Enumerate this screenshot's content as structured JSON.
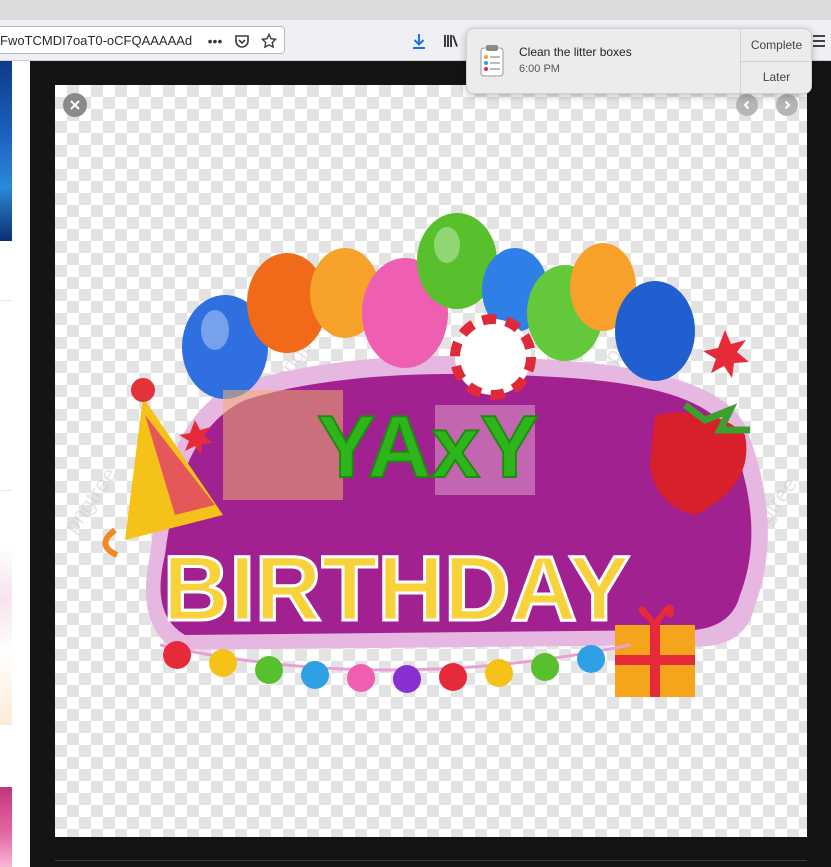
{
  "browser": {
    "url_text": "FwoTCMDI7oaT0-oCFQAAAAAd",
    "icons": {
      "more": "more-actions-icon",
      "pocket": "pocket-icon",
      "bookmark": "bookmark-star-icon",
      "download": "download-icon",
      "library": "library-icon",
      "menu": "hamburger-menu-icon"
    }
  },
  "notification": {
    "title": "Clean the litter boxes",
    "time": "6:00 PM",
    "actions": [
      "Complete",
      "Later"
    ],
    "icon": "reminders-app-icon"
  },
  "lightbox": {
    "close_icon": "close-icon",
    "prev_icon": "chevron-left-icon",
    "next_icon": "chevron-right-icon"
  },
  "image": {
    "line1": "YAxY",
    "line2": "BIRTHDAY",
    "watermark": "pngtree",
    "colors": {
      "banner": "#a0218f",
      "banner_outline": "#e6b7e0",
      "check_light": "#e3e3e3"
    }
  }
}
